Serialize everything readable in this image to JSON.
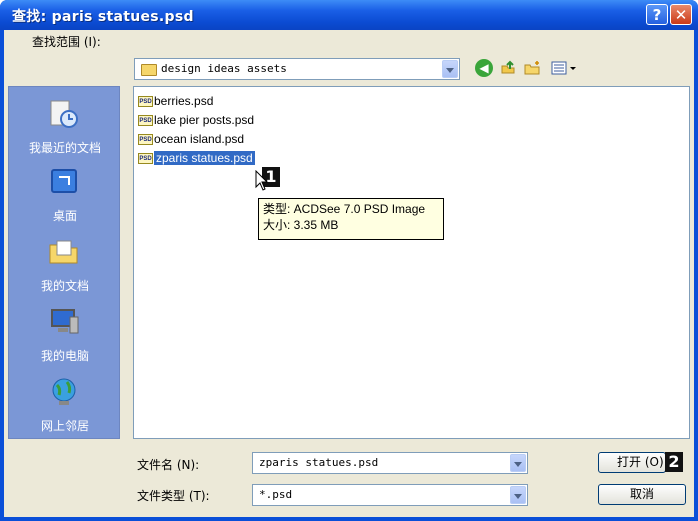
{
  "window": {
    "title": "查找: paris statues.psd"
  },
  "titlebar": {
    "help_label": "?",
    "close_label": "✕"
  },
  "lookin": {
    "label": "查找范围 (I):",
    "value": "design ideas assets"
  },
  "toolbar": {
    "back_icon": "back-icon",
    "up_icon": "up-folder-icon",
    "new_folder_icon": "new-folder-icon",
    "views_icon": "views-menu-icon"
  },
  "places": [
    {
      "label": "我最近的文档",
      "icon": "recent-documents-icon"
    },
    {
      "label": "桌面",
      "icon": "desktop-icon"
    },
    {
      "label": "我的文档",
      "icon": "my-documents-icon"
    },
    {
      "label": "我的电脑",
      "icon": "my-computer-icon"
    },
    {
      "label": "网上邻居",
      "icon": "network-places-icon"
    }
  ],
  "files": [
    {
      "name": "berries.psd",
      "selected": false
    },
    {
      "name": "lake pier posts.psd",
      "selected": false
    },
    {
      "name": "ocean island.psd",
      "selected": false
    },
    {
      "name": "zparis statues.psd",
      "selected": true
    }
  ],
  "file_badge": "PSD",
  "tooltip": {
    "type_line": "类型: ACDSee 7.0 PSD Image",
    "size_line": "大小: 3.35 MB"
  },
  "markers": {
    "m1": "1",
    "m2": "2"
  },
  "filename": {
    "label": "文件名 (N):",
    "value": "zparis statues.psd"
  },
  "filetype": {
    "label": "文件类型 (T):",
    "value": "*.psd"
  },
  "buttons": {
    "open": "打开 (O)",
    "cancel": "取消"
  },
  "colors": {
    "title_bar": "#0a4fd8",
    "places_bar": "#7b97d6",
    "selection": "#316ac5",
    "tooltip_bg": "#ffffe1"
  }
}
